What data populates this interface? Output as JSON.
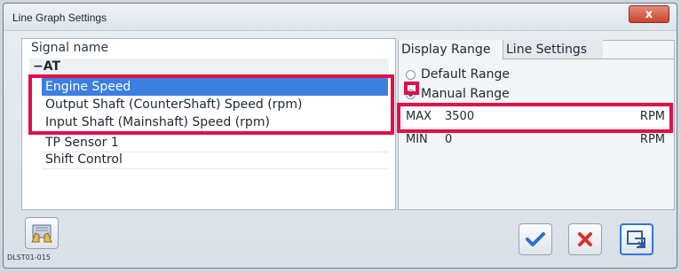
{
  "window": {
    "title": "Line Graph Settings",
    "close_label": "x"
  },
  "signals": {
    "header": "Signal name",
    "group": "AT",
    "group_toggle": "−",
    "items": [
      {
        "label": "Engine Speed",
        "selected": true
      },
      {
        "label": "Output Shaft (CounterShaft) Speed (rpm)",
        "selected": false
      },
      {
        "label": "Input Shaft (Mainshaft) Speed (rpm)",
        "selected": false
      },
      {
        "label": "TP Sensor 1",
        "selected": false
      },
      {
        "label": "Shift Control",
        "selected": false
      }
    ]
  },
  "tabs": {
    "display_range": "Display Range",
    "line_settings": "Line Settings"
  },
  "range": {
    "default_label": "Default Range",
    "manual_label": "Manual Range",
    "selected": "Manual Range",
    "max_label": "MAX",
    "max_value": "3500",
    "max_unit": "RPM",
    "min_label": "MIN",
    "min_value": "0",
    "min_unit": "RPM"
  },
  "footer": {
    "code": "DLST01-015"
  },
  "colors": {
    "highlight": "#e0104a",
    "selection": "#3c7fe0"
  }
}
